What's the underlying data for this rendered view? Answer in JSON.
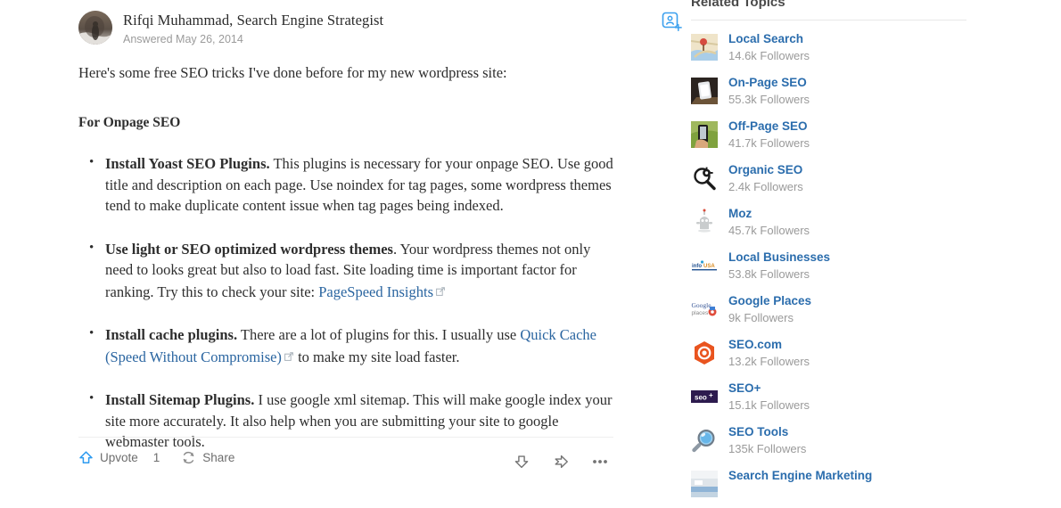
{
  "answer": {
    "author_name": "Rifqi Muhammad, Search Engine Strategist",
    "answered_date": "Answered May 26, 2014",
    "follow_icon": "add-person-icon",
    "avatar_icon": "user-avatar-photo",
    "lead": "Here's some free SEO tricks I've done before for my new wordpress site:",
    "section_heading": "For Onpage SEO",
    "tips": [
      {
        "title": "Install Yoast SEO Plugins.",
        "body": " This plugins is necessary for your onpage SEO. Use good title and description on each page. Use noindex for tag pages, some wordpress themes tend to make duplicate content issue when tag pages being indexed."
      },
      {
        "title": "Use light or SEO optimized wordpress themes",
        "body_before": ". Your wordpress themes not only need to looks great but also to load fast. Site loading time is important factor for ranking. Try this to check your site: ",
        "link_text": "PageSpeed Insights",
        "body_after": ""
      },
      {
        "title": "Install cache plugins.",
        "body_before": " There are a lot of plugins for this. I usually use ",
        "link_text": "Quick Cache (Speed Without Compromise)",
        "body_after": " to make my site load faster."
      },
      {
        "title": "Install Sitemap Plugins.",
        "body": " I use google xml sitemap. This will make google index your site more accurately. It also help when you are submitting your site to google webmaster tools."
      }
    ],
    "footer": {
      "upvote_label": "Upvote",
      "upvote_count": "1",
      "share_label": "Share",
      "upvote_icon": "upvote-arrow-icon",
      "share_icon": "share-circular-arrows-icon",
      "downvote_icon": "downvote-arrow-icon",
      "pass_icon": "pass-forward-arrow-icon",
      "more_icon": "more-options-icon"
    }
  },
  "sidebar": {
    "title": "Related Topics",
    "topics": [
      {
        "name": "Local Search",
        "followers": "14.6k Followers",
        "thumb": "map-pin-thumbnail"
      },
      {
        "name": "On-Page SEO",
        "followers": "55.3k Followers",
        "thumb": "phone-on-desk-thumbnail"
      },
      {
        "name": "Off-Page SEO",
        "followers": "41.7k Followers",
        "thumb": "hand-phone-outdoors-thumbnail"
      },
      {
        "name": "Organic SEO",
        "followers": "2.4k Followers",
        "thumb": "magnifier-gear-icon"
      },
      {
        "name": "Moz",
        "followers": "45.7k Followers",
        "thumb": "moz-robot-icon"
      },
      {
        "name": "Local Businesses",
        "followers": "53.8k Followers",
        "thumb": "infousa-logo-thumbnail"
      },
      {
        "name": "Google Places",
        "followers": "9k Followers",
        "thumb": "google-places-logo-thumbnail"
      },
      {
        "name": "SEO.com",
        "followers": "13.2k Followers",
        "thumb": "seo-dot-com-hexagon-logo"
      },
      {
        "name": "SEO+",
        "followers": "15.1k Followers",
        "thumb": "seo-plus-logo"
      },
      {
        "name": "SEO Tools",
        "followers": "135k Followers",
        "thumb": "blue-magnifier-icon"
      },
      {
        "name": "Search Engine Marketing",
        "followers": "",
        "thumb": "sem-photo-thumbnail"
      }
    ]
  },
  "colors": {
    "link_blue": "#2a65a0",
    "topic_blue": "#2b6dad",
    "upvote_blue": "#2e9bf0",
    "muted_gray": "#9a9a9a",
    "text": "#2e2e2e"
  }
}
